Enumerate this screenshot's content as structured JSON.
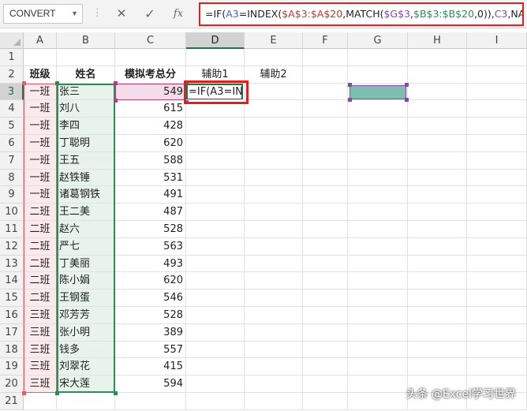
{
  "name_box": "CONVERT",
  "formula_tokens": [
    {
      "t": "=IF(",
      "c": "blk"
    },
    {
      "t": "A3",
      "c": "blue"
    },
    {
      "t": "=INDEX(",
      "c": "blk"
    },
    {
      "t": "$A$3:$A$20",
      "c": "red"
    },
    {
      "t": ",MATCH(",
      "c": "blk"
    },
    {
      "t": "$G$3",
      "c": "purple"
    },
    {
      "t": ",",
      "c": "blk"
    },
    {
      "t": "$B$3:$B$20",
      "c": "green"
    },
    {
      "t": ",0)),",
      "c": "blk"
    },
    {
      "t": "C3",
      "c": "purple"
    },
    {
      "t": ",NA())",
      "c": "blk"
    }
  ],
  "icons": {
    "cancel": "✕",
    "enter": "✓",
    "fx": "fx",
    "separator": "⋮",
    "dropdown": "▼"
  },
  "columns": [
    "A",
    "B",
    "C",
    "D",
    "E",
    "F",
    "G",
    "H",
    "I"
  ],
  "row_numbers": [
    "1",
    "2",
    "3",
    "4",
    "5",
    "6",
    "7",
    "8",
    "9",
    "10",
    "11",
    "12",
    "13",
    "14",
    "15",
    "16",
    "17",
    "18",
    "19",
    "20",
    "21"
  ],
  "headers": {
    "a": "班级",
    "b": "姓名",
    "c": "模拟考总分",
    "d": "辅助1",
    "e": "辅助2"
  },
  "rows": [
    {
      "cls": "一班",
      "name": "张三",
      "score": "549"
    },
    {
      "cls": "一班",
      "name": "刘八",
      "score": "615"
    },
    {
      "cls": "一班",
      "name": "李四",
      "score": "428"
    },
    {
      "cls": "一班",
      "name": "丁聪明",
      "score": "620"
    },
    {
      "cls": "一班",
      "name": "王五",
      "score": "588"
    },
    {
      "cls": "一班",
      "name": "赵铁锤",
      "score": "531"
    },
    {
      "cls": "一班",
      "name": "诸葛钢铁",
      "score": "491"
    },
    {
      "cls": "二班",
      "name": "王二美",
      "score": "487"
    },
    {
      "cls": "二班",
      "name": "赵六",
      "score": "528"
    },
    {
      "cls": "二班",
      "name": "严七",
      "score": "563"
    },
    {
      "cls": "二班",
      "name": "丁美丽",
      "score": "493"
    },
    {
      "cls": "二班",
      "name": "陈小娟",
      "score": "620"
    },
    {
      "cls": "二班",
      "name": "王钢蛋",
      "score": "546"
    },
    {
      "cls": "三班",
      "name": "邓芳芳",
      "score": "528"
    },
    {
      "cls": "三班",
      "name": "张小明",
      "score": "389"
    },
    {
      "cls": "三班",
      "name": "钱多",
      "score": "557"
    },
    {
      "cls": "三班",
      "name": "刘翠花",
      "score": "415"
    },
    {
      "cls": "三班",
      "name": "宋大莲",
      "score": "594"
    }
  ],
  "editing_cell_text": "=IF(A3=IN",
  "colors": {
    "range_a": "#e06070",
    "range_b": "#2e8b57",
    "range_c": "#b04080",
    "range_g": "#8e44ad",
    "g3_fill": "#7cbfb0",
    "highlight_red": "#e02020",
    "selected": "#217346"
  },
  "watermark": "头条 @Excel学习世界"
}
